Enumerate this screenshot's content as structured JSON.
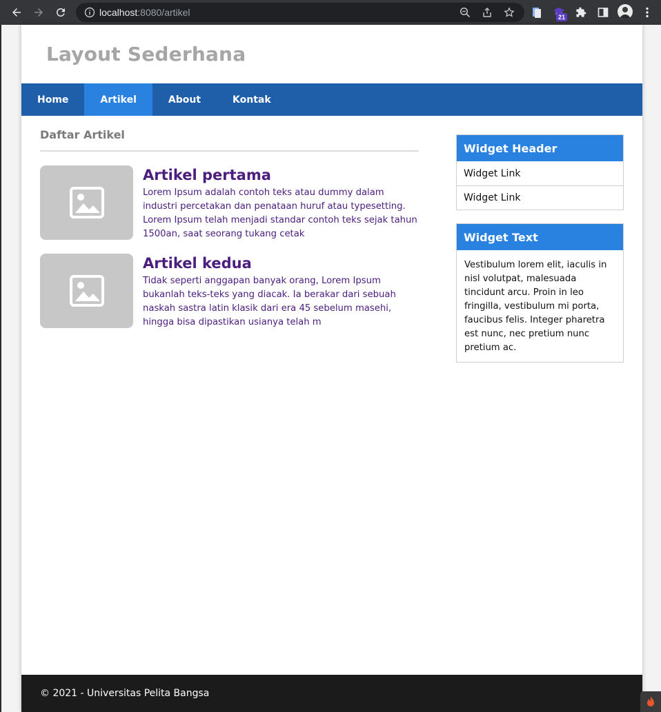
{
  "browser": {
    "url_host": "localhost",
    "url_rest": ":8080/artikel",
    "extension_badge": "21"
  },
  "site": {
    "title": "Layout Sederhana",
    "nav": [
      {
        "label": "Home"
      },
      {
        "label": "Artikel",
        "active": true
      },
      {
        "label": "About"
      },
      {
        "label": "Kontak"
      }
    ]
  },
  "main": {
    "section_title": "Daftar Artikel",
    "articles": [
      {
        "title": "Artikel pertama",
        "body": "Lorem Ipsum adalah contoh teks atau dummy dalam industri percetakan dan penataan huruf atau typesetting. Lorem Ipsum telah menjadi standar contoh teks sejak tahun 1500an, saat seorang tukang cetak"
      },
      {
        "title": "Artikel kedua",
        "body": "Tidak seperti anggapan banyak orang, Lorem Ipsum bukanlah teks-teks yang diacak. Ia berakar dari sebuah naskah sastra latin klasik dari era 45 sebelum masehi, hingga bisa dipastikan usianya telah m"
      }
    ]
  },
  "sidebar": {
    "widget_links": {
      "header": "Widget Header",
      "links": [
        "Widget Link",
        "Widget Link"
      ]
    },
    "widget_text": {
      "header": "Widget Text",
      "body": "Vestibulum lorem elit, iaculis in nisl volutpat, malesuada tincidunt arcu. Proin in leo fringilla, vestibulum mi porta, faucibus felis. Integer pharetra est nunc, nec pretium nunc pretium ac."
    }
  },
  "footer": {
    "text": "© 2021 - Universitas Pelita Bangsa"
  },
  "colors": {
    "nav_bg": "#1f5faa",
    "nav_active": "#2a82e0",
    "widget_header": "#2a82e0",
    "article_text": "#4b1d7e",
    "footer_bg": "#1b1b1b"
  }
}
